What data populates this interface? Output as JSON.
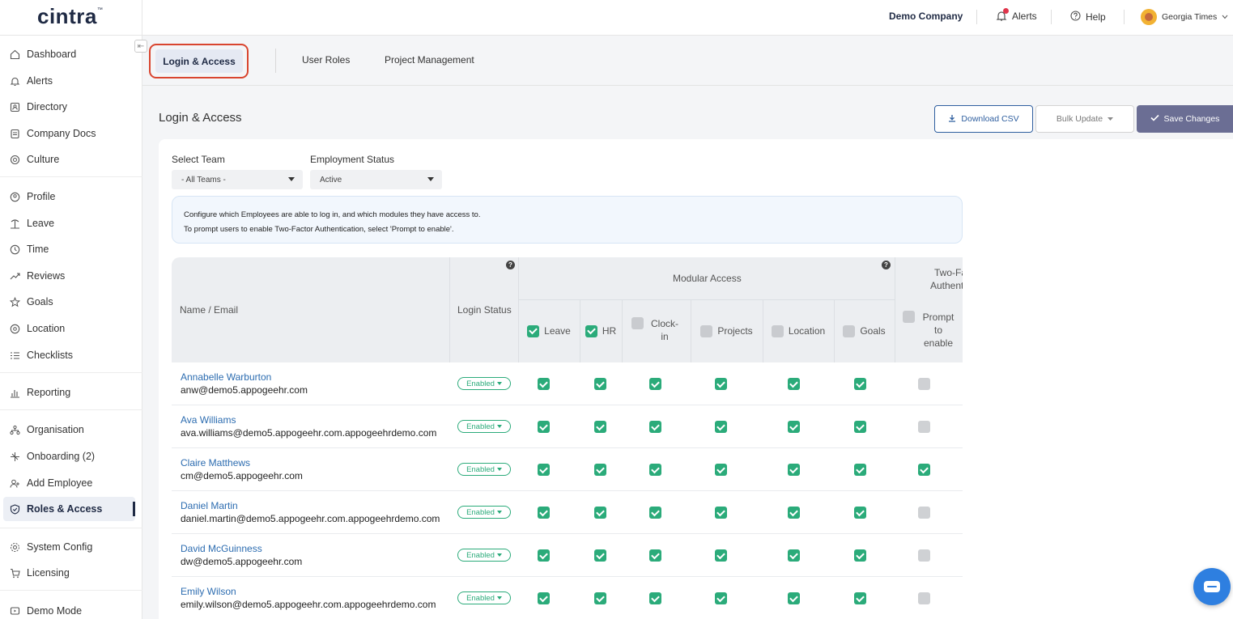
{
  "brand": {
    "logo": "cintra",
    "tm": "™"
  },
  "topbar": {
    "company": "Demo Company",
    "alerts_label": "Alerts",
    "help_label": "Help",
    "user_name": "Georgia Times"
  },
  "sidebar": {
    "items": [
      {
        "label": "Dashboard",
        "icon": "home-icon"
      },
      {
        "label": "Alerts",
        "icon": "bell-icon"
      },
      {
        "label": "Directory",
        "icon": "directory-icon"
      },
      {
        "label": "Company Docs",
        "icon": "document-icon"
      },
      {
        "label": "Culture",
        "icon": "culture-icon"
      },
      {
        "label": "Profile",
        "icon": "profile-icon"
      },
      {
        "label": "Leave",
        "icon": "beach-icon"
      },
      {
        "label": "Time",
        "icon": "clock-icon"
      },
      {
        "label": "Reviews",
        "icon": "trend-icon"
      },
      {
        "label": "Goals",
        "icon": "star-icon"
      },
      {
        "label": "Location",
        "icon": "location-pin-icon"
      },
      {
        "label": "Checklists",
        "icon": "checklist-icon"
      },
      {
        "label": "Reporting",
        "icon": "bar-chart-icon"
      },
      {
        "label": "Organisation",
        "icon": "org-chart-icon"
      },
      {
        "label": "Onboarding (2)",
        "icon": "onboarding-icon"
      },
      {
        "label": "Add Employee",
        "icon": "add-user-icon"
      },
      {
        "label": "Roles & Access",
        "icon": "shield-icon",
        "active": true
      },
      {
        "label": "System Config",
        "icon": "gear-icon"
      },
      {
        "label": "Licensing",
        "icon": "cart-icon"
      },
      {
        "label": "Demo Mode",
        "icon": "demo-icon"
      }
    ]
  },
  "tabs": [
    {
      "label": "Login & Access",
      "active": true
    },
    {
      "label": "User Roles"
    },
    {
      "label": "Project Management"
    }
  ],
  "page": {
    "title": "Login & Access",
    "download_csv": "Download CSV",
    "bulk_update": "Bulk Update",
    "save_changes": "Save Changes"
  },
  "filters": {
    "team_label": "Select Team",
    "team_value": "- All Teams -",
    "status_label": "Employment Status",
    "status_value": "Active"
  },
  "info": {
    "line1": "Configure which Employees are able to log in, and which modules they have access to.",
    "line2": "To prompt users to enable Two-Factor Authentication, select 'Prompt to enable'."
  },
  "table": {
    "col_name": "Name / Email",
    "col_login": "Login Status",
    "group_modular": "Modular Access",
    "group_2fa": "Two-Factor Authentication",
    "col_2fa_line1": "Two-Fa",
    "col_2fa_line2": "Authentic",
    "module_columns": [
      {
        "label": "Leave",
        "checked": true
      },
      {
        "label": "HR",
        "checked": true
      },
      {
        "label": "Clock-in",
        "checked": false
      },
      {
        "label": "Projects",
        "checked": false
      },
      {
        "label": "Location",
        "checked": false
      },
      {
        "label": "Goals",
        "checked": false
      }
    ],
    "prompt_column": {
      "label": "Prompt to enable",
      "checked": false
    },
    "rows": [
      {
        "name": "Annabelle Warburton",
        "email": "anw@demo5.appogeehr.com",
        "status": "Enabled",
        "modules": [
          true,
          true,
          true,
          true,
          true,
          true
        ],
        "prompt": false
      },
      {
        "name": "Ava Williams",
        "email": "ava.williams@demo5.appogeehr.com.appogeehrdemo.com",
        "status": "Enabled",
        "modules": [
          true,
          true,
          true,
          true,
          true,
          true
        ],
        "prompt": false
      },
      {
        "name": "Claire Matthews",
        "email": "cm@demo5.appogeehr.com",
        "status": "Enabled",
        "modules": [
          true,
          true,
          true,
          true,
          true,
          true
        ],
        "prompt": true
      },
      {
        "name": "Daniel Martin",
        "email": "daniel.martin@demo5.appogeehr.com.appogeehrdemo.com",
        "status": "Enabled",
        "modules": [
          true,
          true,
          true,
          true,
          true,
          true
        ],
        "prompt": false
      },
      {
        "name": "David McGuinness",
        "email": "dw@demo5.appogeehr.com",
        "status": "Enabled",
        "modules": [
          true,
          true,
          true,
          true,
          true,
          true
        ],
        "prompt": false
      },
      {
        "name": "Emily Wilson",
        "email": "emily.wilson@demo5.appogeehr.com.appogeehrdemo.com",
        "status": "Enabled",
        "modules": [
          true,
          true,
          true,
          true,
          true,
          true
        ],
        "prompt": false
      }
    ]
  },
  "colors": {
    "accent_green": "#2bab7a",
    "link_blue": "#2c6cb0",
    "navy": "#1f2a44",
    "save_purple": "#6b6e94",
    "highlight_red": "#d9452f",
    "chat_blue": "#2e7fe0"
  }
}
